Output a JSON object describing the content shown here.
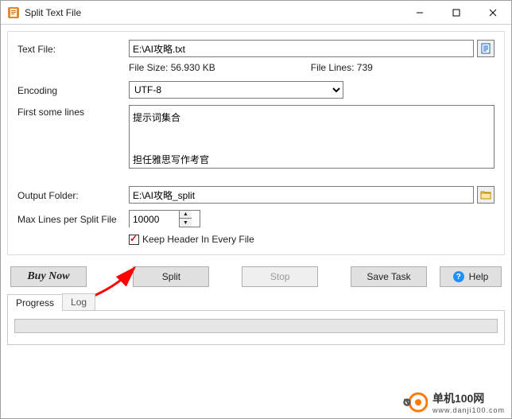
{
  "window": {
    "title": "Split Text File"
  },
  "form": {
    "textfile_label": "Text File:",
    "textfile_value": "E:\\AI攻略.txt",
    "filesize_label": "File Size:",
    "filesize_value": "56.930 KB",
    "filelines_label": "File Lines:",
    "filelines_value": "739",
    "encoding_label": "Encoding",
    "encoding_value": "UTF-8",
    "firstlines_label": "First some lines",
    "firstlines_value": "提示词集合\n\n担任雅思写作考官",
    "outputfolder_label": "Output Folder:",
    "outputfolder_value": "E:\\AI攻略_split",
    "maxlines_label": "Max Lines per Split File",
    "maxlines_value": "10000",
    "keepheader_label": "Keep Header In Every File",
    "keepheader_checked": true
  },
  "buttons": {
    "buynow": "Buy Now",
    "split": "Split",
    "stop": "Stop",
    "savetask": "Save Task",
    "help": "Help"
  },
  "tabs": {
    "progress": "Progress",
    "log": "Log"
  },
  "watermark": {
    "name": "单机100网",
    "url": "www.danji100.com"
  }
}
